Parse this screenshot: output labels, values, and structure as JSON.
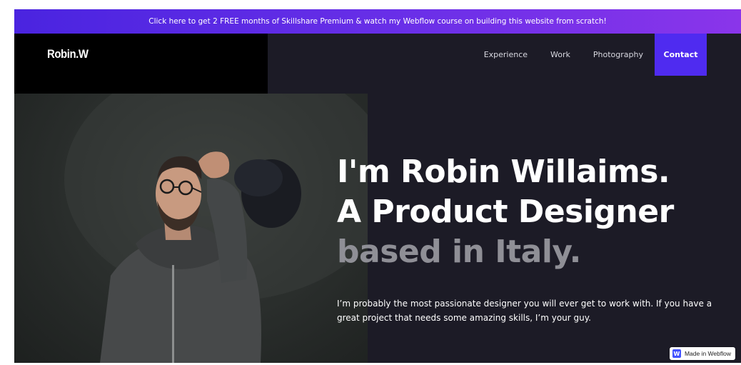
{
  "promo_banner": {
    "text": "Click here to get 2 FREE months of Skillshare Premium & watch my Webflow course on building this website from scratch!"
  },
  "header": {
    "logo": "Robin.W",
    "nav": [
      {
        "label": "Experience"
      },
      {
        "label": "Work"
      },
      {
        "label": "Photography"
      },
      {
        "label": "Contact"
      }
    ]
  },
  "hero": {
    "headline_line1": "I'm Robin Willaims.",
    "headline_line2": "A Product Designer",
    "headline_line3": "based in Italy.",
    "intro": "I’m probably the most passionate designer you will ever get to work with. If you have a great project that needs some amazing skills, I’m your guy."
  },
  "webflow_badge": {
    "logo_letter": "W",
    "label": "Made in Webflow"
  },
  "colors": {
    "accent": "#4f2bf0",
    "banner_start": "#4a24e0",
    "banner_end": "#8a35ea",
    "background": "#1c1b26",
    "muted_text": "#8f8f96"
  }
}
